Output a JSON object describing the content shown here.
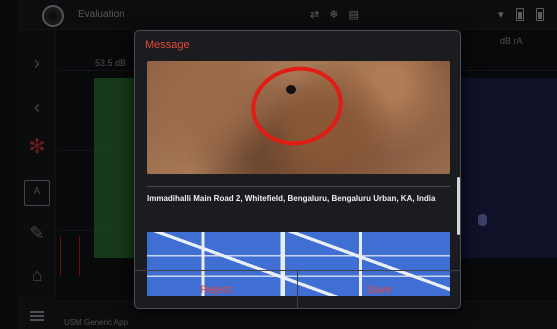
{
  "app": {
    "title": "Evaluation",
    "footer_text": "USM Generic App",
    "value_readout": "53.5 dB",
    "unit_label": "dB rA",
    "top_icons": [
      "⇄",
      "❄",
      "▤"
    ],
    "accent_color": "#e24a3a"
  },
  "modal": {
    "title": "Message",
    "address": "Immadihalli Main Road 2, Whitefield, Bengaluru, Bengaluru Urban, KA, India",
    "reject_label": "Reject",
    "save_label": "Save"
  },
  "icons": {
    "logo": "app-logo-icon",
    "info": "info-icon",
    "snowflake": "snowflake-icon",
    "store": "store-icon"
  }
}
